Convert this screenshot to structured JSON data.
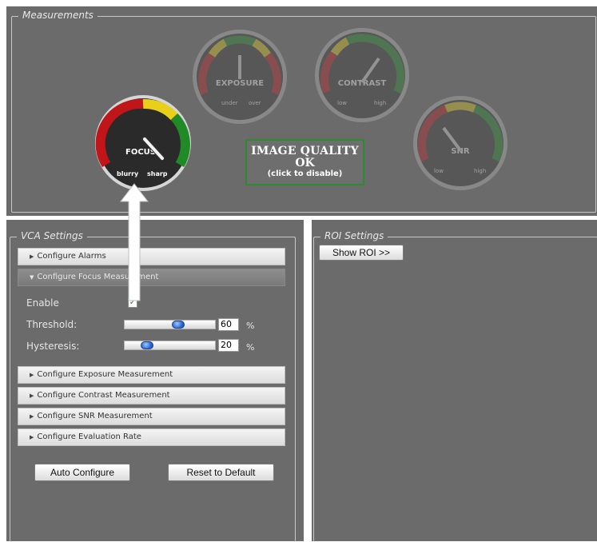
{
  "measurements": {
    "legend": "Measurements",
    "gauges": [
      {
        "name": "FOCUS",
        "low": "blurry",
        "high": "sharp",
        "needle_level": 0.78,
        "active": true
      },
      {
        "name": "EXPOSURE",
        "low": "under",
        "high": "over",
        "needle_level": 0.5,
        "active": false
      },
      {
        "name": "CONTRAST",
        "low": "low",
        "high": "high",
        "needle_level": 0.72,
        "active": false
      },
      {
        "name": "SNR",
        "low": "low",
        "high": "high",
        "needle_level": 0.3,
        "active": false
      }
    ],
    "image_quality": {
      "line1": "IMAGE QUALITY",
      "line2": "OK",
      "line3": "(click to disable)"
    }
  },
  "vca": {
    "legend": "VCA Settings",
    "items": [
      "Configure Alarms",
      "Configure Focus Measurement",
      "Configure Exposure Measurement",
      "Configure Contrast Measurement",
      "Configure SNR Measurement",
      "Configure Evaluation Rate"
    ],
    "focus": {
      "enable_label": "Enable",
      "threshold_label": "Threshold:",
      "threshold_value": "60",
      "hysteresis_label": "Hysteresis:",
      "hysteresis_value": "20",
      "unit": "%",
      "enabled": true
    },
    "buttons": {
      "auto": "Auto Configure",
      "reset": "Reset to Default"
    }
  },
  "roi": {
    "legend": "ROI Settings",
    "show_button": "Show ROI >>"
  },
  "colors": {
    "panel": "#6b6b6b",
    "gauge_red": "#c0161a",
    "gauge_yellow": "#e8cf1a",
    "gauge_green": "#1f8a26",
    "iq_border": "#2f8a2f"
  }
}
